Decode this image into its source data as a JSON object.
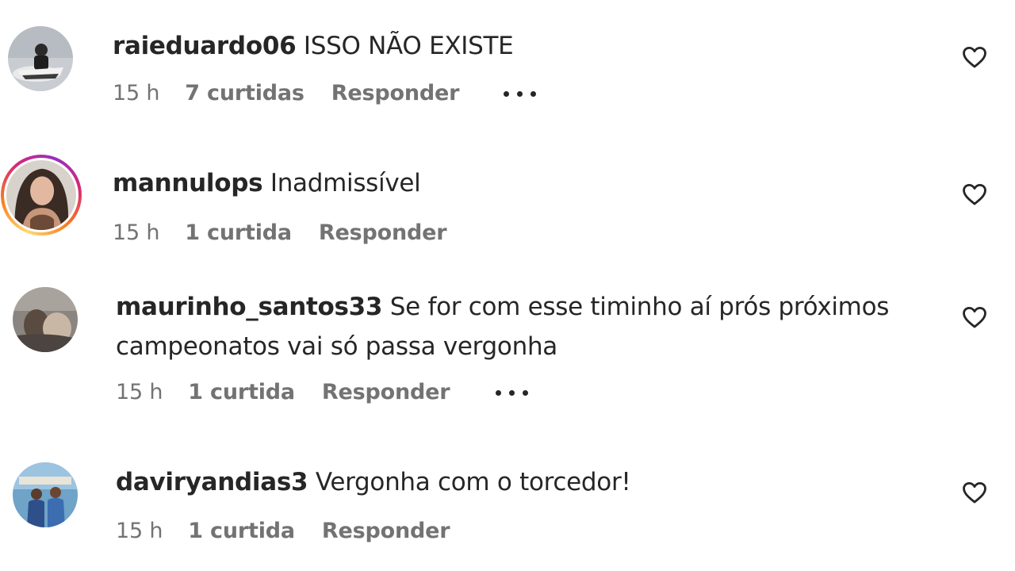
{
  "comments": [
    {
      "username": "raieduardo06",
      "text": " ISSO NÃO EXISTE",
      "time": "15 h",
      "likes": "7 curtidas",
      "reply": "Responder",
      "has_more": true,
      "story_ring": false
    },
    {
      "username": "mannulops",
      "text": " Inadmissível",
      "time": "15 h",
      "likes": "1 curtida",
      "reply": "Responder",
      "has_more": false,
      "story_ring": true
    },
    {
      "username": "maurinho_santos33",
      "text": " Se for com esse timinho aí prós próximos campeonatos vai só passa vergonha",
      "time": "15 h",
      "likes": "1 curtida",
      "reply": "Responder",
      "has_more": true,
      "story_ring": false
    },
    {
      "username": "daviryandias3",
      "text": " Vergonha com o torcedor!",
      "time": "15 h",
      "likes": "1 curtida",
      "reply": "Responder",
      "has_more": false,
      "story_ring": false
    }
  ],
  "icons": {
    "like": "heart-outline-icon",
    "more": "more-options-icon"
  },
  "colors": {
    "primary_text": "#262626",
    "secondary_text": "#737373",
    "story_ring": "#d62976"
  }
}
